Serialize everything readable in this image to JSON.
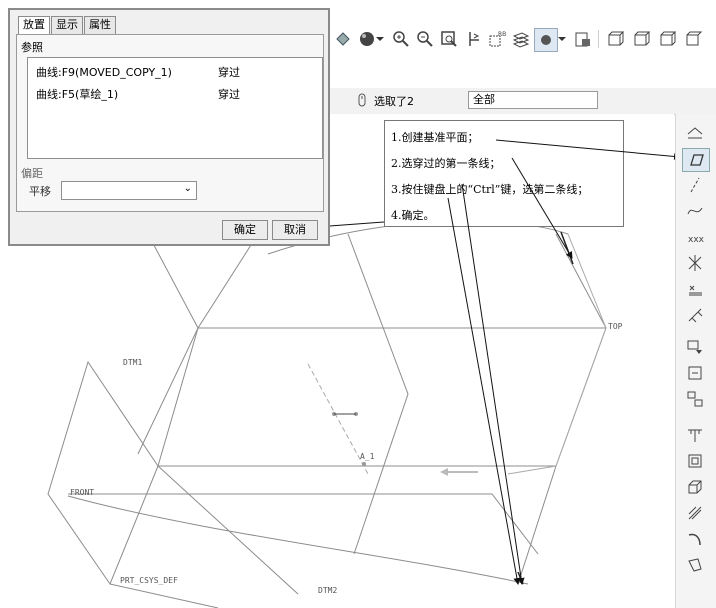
{
  "dialog": {
    "tabs": [
      {
        "label": "放置",
        "active": true
      },
      {
        "label": "显示",
        "active": false
      },
      {
        "label": "属性",
        "active": false
      }
    ],
    "references_label": "参照",
    "references": [
      {
        "name": "曲线:F9(MOVED_COPY_1)",
        "type": "穿过"
      },
      {
        "name": "曲线:F5(草绘_1)",
        "type": "穿过"
      }
    ],
    "offset_label": "偏距",
    "shift_label": "平移",
    "shift_value": "",
    "ok_label": "确定",
    "cancel_label": "取消"
  },
  "filter_bar": {
    "selected_count": "选取了2",
    "filter_value": "全部"
  },
  "annotation": {
    "steps": [
      "1.创建基准平面；",
      "2.选穿过的第一条线；",
      "3.按住键盘上的“Ctrl”键，选第二条线；",
      "4.确定。"
    ]
  },
  "model_labels": {
    "top": "TOP",
    "dtm1": "DTM1",
    "front": "FRONT",
    "a1": "A_1",
    "csys": "PRT_CSYS_DEF",
    "dtm2": "DTM2"
  },
  "toolbar_icons": [
    "paint-icon",
    "sphere-icon",
    "dropdown-icon",
    "zoom-in-icon",
    "zoom-out-icon",
    "zoom-fit-icon",
    "reorient-icon",
    "saved-views-icon",
    "layers-icon",
    "shading-icon",
    "dropdown-icon",
    "render-icon",
    "view-box1-icon",
    "view-box2-icon",
    "view-box3-icon"
  ],
  "right_tool_icons": [
    "datum-toggle-icon",
    "datum-plane-icon",
    "datum-axis-icon",
    "datum-curve-icon",
    "datum-point-icon",
    "sketch-point-icon",
    "offset-point-icon",
    "csys-icon",
    "analysis-icon",
    "insert-icon",
    "pattern-icon",
    "extrude-icon",
    "revolve-icon",
    "sweep-icon",
    "blend-icon",
    "shell-icon",
    "rib-icon",
    "draft-icon"
  ]
}
